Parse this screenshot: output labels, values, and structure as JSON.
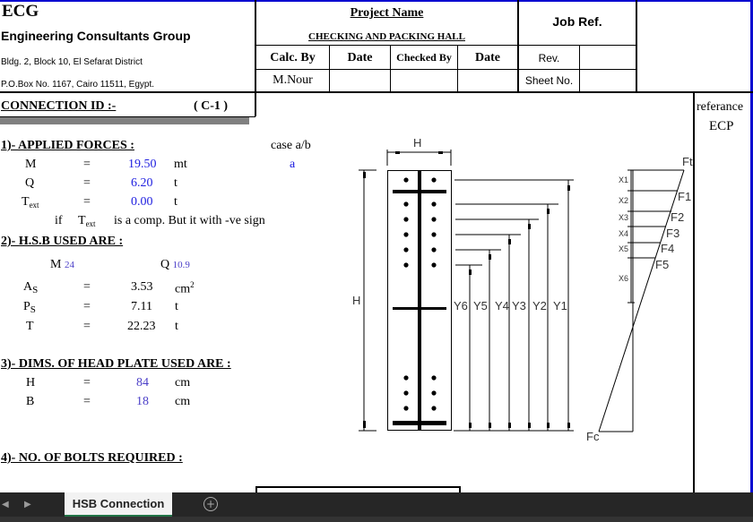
{
  "header": {
    "company_abbr": "ECG",
    "company_name": "Engineering Consultants Group",
    "address_line1": "Bldg. 2, Block 10, El Sefarat District",
    "address_line2": "P.O.Box No. 1167, Cairo 11511, Egypt.",
    "project_label": "Project Name",
    "project_name": "CHECKING AND PACKING HALL",
    "job_ref_label": "Job Ref.",
    "calc_by_label": "Calc. By",
    "date_label_1": "Date",
    "checked_by_label": "Checked By",
    "date_label_2": "Date",
    "rev_label": "Rev.",
    "sheet_no_label": "Sheet No.",
    "calc_by_value": "M.Nour"
  },
  "reference": {
    "label": "referance",
    "value": "ECP"
  },
  "connection": {
    "label": "CONNECTION ID :-",
    "id": "( C-1 )"
  },
  "section1": {
    "title": "1)- APPLIED FORCES :",
    "case_label": "case a/b",
    "case_value": "a",
    "rows": [
      {
        "symbol": "M",
        "sub": "",
        "eq": "=",
        "value": "19.50",
        "unit": "mt"
      },
      {
        "symbol": "Q",
        "sub": "",
        "eq": "=",
        "value": "6.20",
        "unit": "t"
      },
      {
        "symbol": "T",
        "sub": "ext",
        "eq": "=",
        "value": "0.00",
        "unit": "t"
      }
    ],
    "note_if": "if",
    "note_symbol": "T",
    "note_sub": "ext",
    "note_text": "is a comp. But it with -ve sign"
  },
  "section2": {
    "title": "2)- H.S.B USED ARE :",
    "bolt_letter": "M",
    "bolt_size": "24",
    "grade_letter": "Q",
    "grade_value": "10.9",
    "rows": [
      {
        "symbol": "A",
        "sub": "S",
        "eq": "=",
        "value": "3.53",
        "unit": "cm",
        "unit_sup": "2"
      },
      {
        "symbol": "P",
        "sub": "S",
        "eq": "=",
        "value": "7.11",
        "unit": "t",
        "unit_sup": ""
      },
      {
        "symbol": "T",
        "sub": "",
        "eq": "=",
        "value": "22.23",
        "unit": "t",
        "unit_sup": ""
      }
    ]
  },
  "section3": {
    "title": "3)- DIMS. OF HEAD PLATE USED ARE :",
    "rows": [
      {
        "symbol": "H",
        "eq": "=",
        "value": "84",
        "unit": "cm"
      },
      {
        "symbol": "B",
        "eq": "=",
        "value": "18",
        "unit": "cm"
      }
    ]
  },
  "section4": {
    "title": "4)- NO. OF BOLTS REQUIRED :"
  },
  "diagram": {
    "width_label": "H",
    "height_label": "H",
    "y_labels": [
      "Y6",
      "Y5",
      "Y4",
      "Y3",
      "Y2",
      "Y1"
    ],
    "x_labels": [
      "X1",
      "X2",
      "X3",
      "X4",
      "X5",
      "X6"
    ],
    "force_labels": [
      "Ft",
      "F1",
      "F2",
      "F3",
      "F4",
      "F5",
      "Fc"
    ]
  },
  "tabs": {
    "sheets": [
      "HSB Connection"
    ],
    "active": "HSB Connection",
    "add_icon": "plus-circle-icon",
    "prev_icon": "chevron-left-icon",
    "next_icon": "chevron-right-icon"
  }
}
